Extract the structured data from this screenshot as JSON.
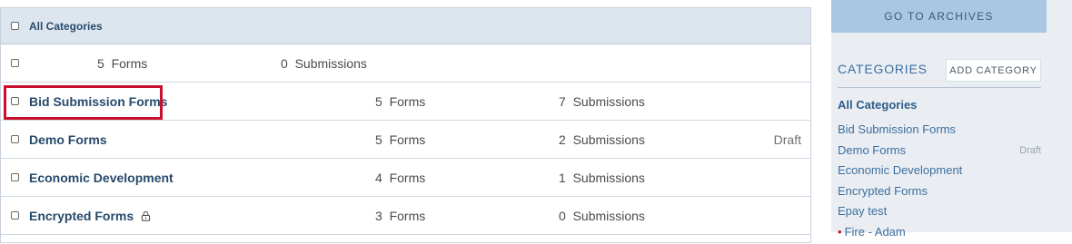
{
  "table": {
    "header_label": "All Categories",
    "rows": [
      {
        "name": "",
        "forms": "5  Forms",
        "submissions": "0  Submissions",
        "status": ""
      },
      {
        "name": "Bid Submission Forms",
        "forms": "5  Forms",
        "submissions": "7  Submissions",
        "status": ""
      },
      {
        "name": "Demo Forms",
        "forms": "5  Forms",
        "submissions": "2  Submissions",
        "status": "Draft"
      },
      {
        "name": "Economic Development",
        "forms": "4  Forms",
        "submissions": "1  Submissions",
        "status": ""
      },
      {
        "name": "Encrypted Forms",
        "forms": "3  Forms",
        "submissions": "0  Submissions",
        "status": ""
      }
    ]
  },
  "sidebar": {
    "archives_label": "GO TO ARCHIVES",
    "categories_heading": "CATEGORIES",
    "add_category_label": "ADD CATEGORY",
    "items": [
      {
        "label": "All Categories",
        "tag": ""
      },
      {
        "label": "Bid Submission Forms",
        "tag": ""
      },
      {
        "label": "Demo Forms",
        "tag": "Draft"
      },
      {
        "label": "Economic Development",
        "tag": ""
      },
      {
        "label": "Encrypted Forms",
        "tag": ""
      },
      {
        "label": "Epay test",
        "tag": ""
      },
      {
        "label": "Fire - Adam",
        "tag": ""
      }
    ]
  },
  "colors": {
    "highlight": "#c8102e",
    "header_bg": "#dde6ef",
    "sidebar_bg": "#eaeef3",
    "archives_bg": "#a9c6e2"
  },
  "icons": {
    "encrypted": "lock-icon"
  }
}
